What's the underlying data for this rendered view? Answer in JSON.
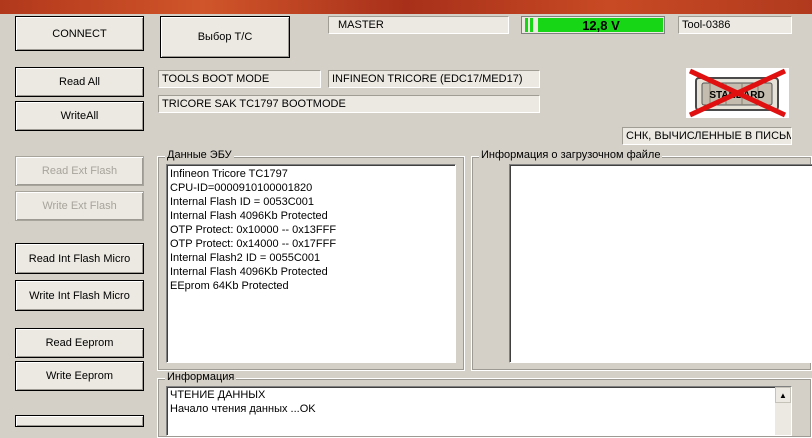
{
  "header": {
    "mode_field": "MASTER",
    "voltage": "12,8 V",
    "voltage_color": "#16d616",
    "tool_id": "Tool-0386"
  },
  "buttons": {
    "connect": "CONNECT",
    "select_vehicle": "Выбор Т/С",
    "read_all": "Read All",
    "write_all": "WriteAll",
    "read_ext_flash": "Read Ext Flash",
    "write_ext_flash": "Write Ext Flash",
    "read_int_flash": "Read Int Flash Micro",
    "write_int_flash": "Write Int Flash Micro",
    "read_eeprom": "Read Eeprom",
    "write_eeprom": "Write Eeprom"
  },
  "info_fields": {
    "boot_mode": "TOOLS BOOT MODE",
    "ecu_family": "INFINEON TRICORE (EDC17/MED17)",
    "cpu_mode": "TRICORE SAK TC1797  BOOTMODE",
    "checksum": "СНК, ВЫЧИСЛЕННЫЕ В ПИСЬМЕН"
  },
  "logo": {
    "text": "STANDARD",
    "icon": "standard-crossed-icon"
  },
  "ecu_data": {
    "title": "Данные ЭБУ",
    "lines": [
      "Infineon Tricore TC1797",
      "CPU-ID=0000910100001820",
      "Internal Flash ID = 0053C001",
      "Internal Flash 4096Kb  Protected",
      "OTP Protect: 0x10000 -- 0x13FFF",
      "OTP Protect: 0x14000 -- 0x17FFF",
      "Internal Flash2 ID = 0055C001",
      "Internal Flash 4096Kb  Protected",
      "EEprom 64Kb  Protected"
    ]
  },
  "boot_file": {
    "title": "Информация о загрузочном файле"
  },
  "log": {
    "title": "Информация",
    "lines": [
      "ЧТЕНИЕ ДАННЫХ",
      "Начало чтения данных ...OK"
    ]
  }
}
